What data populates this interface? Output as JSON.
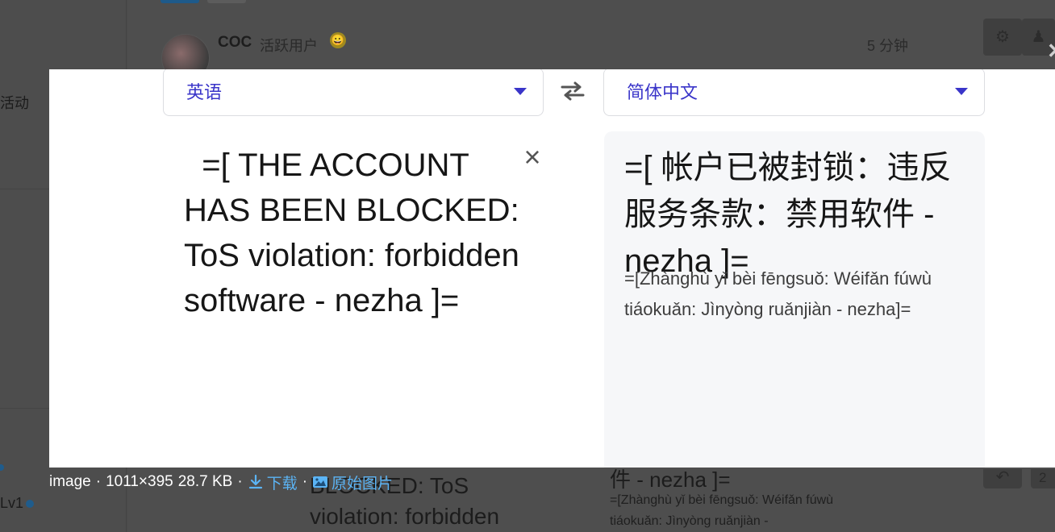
{
  "background": {
    "username": "COC",
    "user_title": "活跃用户",
    "emoji": "😀",
    "post_time": "5 分钟",
    "sidebar_activity": "活动",
    "sidebar_level": "Lv1",
    "reply_count": "2",
    "dup_source_text": "BLOCKED: ToS\nviolation: forbidden",
    "dup_target_text": "件 - nezha ]=",
    "dup_pinyin": "=[Zhànghù yǐ bèi fēngsuǒ: Wéifǎn fúwù tiáokuǎn: Jìnyòng ruǎnjiàn -"
  },
  "translator": {
    "source_language": "英语",
    "target_language": "简体中文",
    "source_text": "  =[ THE ACCOUNT HAS BEEN BLOCKED: ToS violation: forbidden software - nezha ]=",
    "translated_text": "=[ 帐户已被封锁：违反服务条款：禁用软件 - nezha ]=",
    "pinyin": "=[Zhànghù yǐ bèi fēngsuǒ: Wéifǎn fúwù tiáokuǎn: Jìnyòng ruǎnjiàn - nezha]=",
    "clear_icon": "×"
  },
  "caption": {
    "filename": "image",
    "dimensions": "1011×395",
    "filesize": "28.7 KB",
    "separator": "·",
    "download_label": "下载",
    "original_label": "原始图片"
  },
  "colors": {
    "accent": "#3a35c9",
    "link": "#5bb4f5",
    "overlay": "#4e4e4e"
  }
}
